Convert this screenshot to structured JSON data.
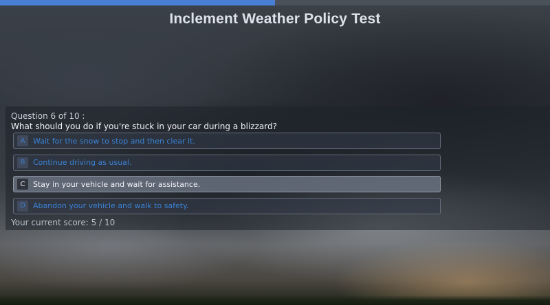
{
  "header": {
    "title": "Inclement Weather Policy Test",
    "progress_fraction": 0.5
  },
  "question": {
    "number_label": "Question 6 of 10 :",
    "text": "What should you do if you're stuck in your car during a blizzard?"
  },
  "answers": [
    {
      "letter": "A",
      "text": "Wait for the snow to stop and then clear it.",
      "selected": false
    },
    {
      "letter": "B",
      "text": "Continue driving as usual.",
      "selected": false
    },
    {
      "letter": "C",
      "text": "Stay in your vehicle and wait for assistance.",
      "selected": true
    },
    {
      "letter": "D",
      "text": "Abandon your vehicle and walk to safety.",
      "selected": false
    }
  ],
  "score": {
    "label": "Your current score: 5 / 10"
  },
  "colors": {
    "accent": "#4a7fd6",
    "answer_text": "#3b82d6",
    "selected_bg": "#6e7684"
  }
}
